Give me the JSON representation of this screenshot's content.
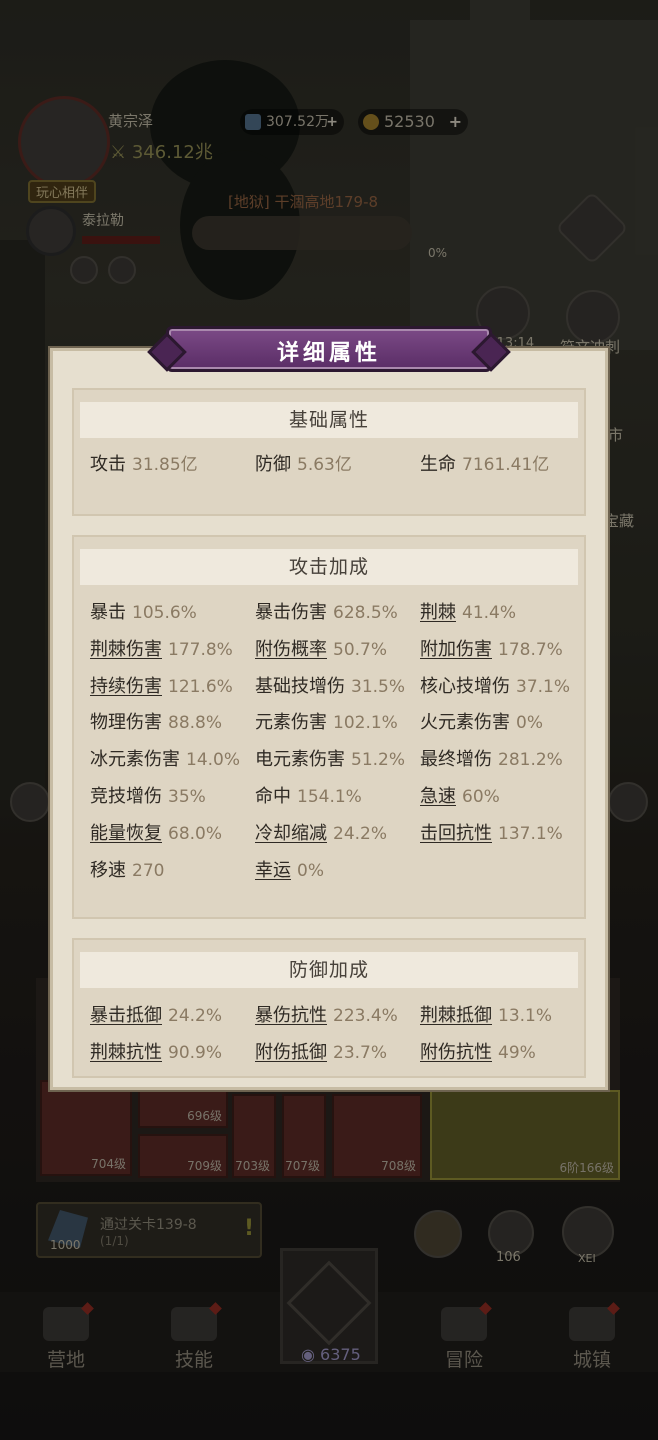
{
  "hud": {
    "player_name": "黄宗泽",
    "power": "346.12兆",
    "badge": "玩心相伴",
    "gems": "307.52万",
    "coins": "52530",
    "companion_name": "泰拉勒",
    "stage": "[地狱] 干涸高地179-8",
    "progress_pct": "0%",
    "side_timer": "2:13:14",
    "side_menu_1": "符文冲刺",
    "side_menu_2": "市",
    "side_menu_3": "宝藏"
  },
  "dialog": {
    "title": "详细属性",
    "sections": [
      {
        "title": "基础属性",
        "stats": [
          {
            "label": "攻击",
            "value": "31.85亿",
            "underline": false
          },
          {
            "label": "防御",
            "value": "5.63亿",
            "underline": false
          },
          {
            "label": "生命",
            "value": "7161.41亿",
            "underline": false
          }
        ]
      },
      {
        "title": "攻击加成",
        "stats": [
          {
            "label": "暴击",
            "value": "105.6%",
            "underline": false
          },
          {
            "label": "暴击伤害",
            "value": "628.5%",
            "underline": false
          },
          {
            "label": "荆棘",
            "value": "41.4%",
            "underline": true
          },
          {
            "label": "荆棘伤害",
            "value": "177.8%",
            "underline": true
          },
          {
            "label": "附伤概率",
            "value": "50.7%",
            "underline": true
          },
          {
            "label": "附加伤害",
            "value": "178.7%",
            "underline": true
          },
          {
            "label": "持续伤害",
            "value": "121.6%",
            "underline": true
          },
          {
            "label": "基础技增伤",
            "value": "31.5%",
            "underline": false
          },
          {
            "label": "核心技增伤",
            "value": "37.1%",
            "underline": false
          },
          {
            "label": "物理伤害",
            "value": "88.8%",
            "underline": false
          },
          {
            "label": "元素伤害",
            "value": "102.1%",
            "underline": false
          },
          {
            "label": "火元素伤害",
            "value": "0%",
            "underline": false
          },
          {
            "label": "冰元素伤害",
            "value": "14.0%",
            "underline": false
          },
          {
            "label": "电元素伤害",
            "value": "51.2%",
            "underline": false
          },
          {
            "label": "最终增伤",
            "value": "281.2%",
            "underline": false
          },
          {
            "label": "竞技增伤",
            "value": "35%",
            "underline": false
          },
          {
            "label": "命中",
            "value": "154.1%",
            "underline": false
          },
          {
            "label": "急速",
            "value": "60%",
            "underline": true
          },
          {
            "label": "能量恢复",
            "value": "68.0%",
            "underline": true
          },
          {
            "label": "冷却缩减",
            "value": "24.2%",
            "underline": true
          },
          {
            "label": "击回抗性",
            "value": "137.1%",
            "underline": true
          },
          {
            "label": "移速",
            "value": "270",
            "underline": false
          },
          {
            "label": "幸运",
            "value": "0%",
            "underline": true
          }
        ]
      },
      {
        "title": "防御加成",
        "stats": [
          {
            "label": "暴击抵御",
            "value": "24.2%",
            "underline": true
          },
          {
            "label": "暴伤抗性",
            "value": "223.4%",
            "underline": true
          },
          {
            "label": "荆棘抵御",
            "value": "13.1%",
            "underline": true
          },
          {
            "label": "荆棘抗性",
            "value": "90.9%",
            "underline": true
          },
          {
            "label": "附伤抵御",
            "value": "23.7%",
            "underline": true
          },
          {
            "label": "附伤抗性",
            "value": "49%",
            "underline": true
          }
        ]
      }
    ]
  },
  "equipment": {
    "levels": [
      "704级",
      "696级",
      "709级",
      "703级",
      "707级",
      "708级",
      "6阶166级"
    ]
  },
  "quest": {
    "text": "通过关卡139-8",
    "progress": "(1/1)",
    "reward": "1000"
  },
  "buttons": {
    "gear_count": "106",
    "xei_label": "XEI"
  },
  "bottom_nav": {
    "camp": "营地",
    "skills": "技能",
    "battle_currency": "6375",
    "adventure": "冒险",
    "town": "城镇"
  },
  "colors": {
    "title_banner": "#6b3c77",
    "dialog_bg": "#e6dfcf",
    "section_bg": "#ded5c3",
    "value_text": "#8a7a63"
  }
}
